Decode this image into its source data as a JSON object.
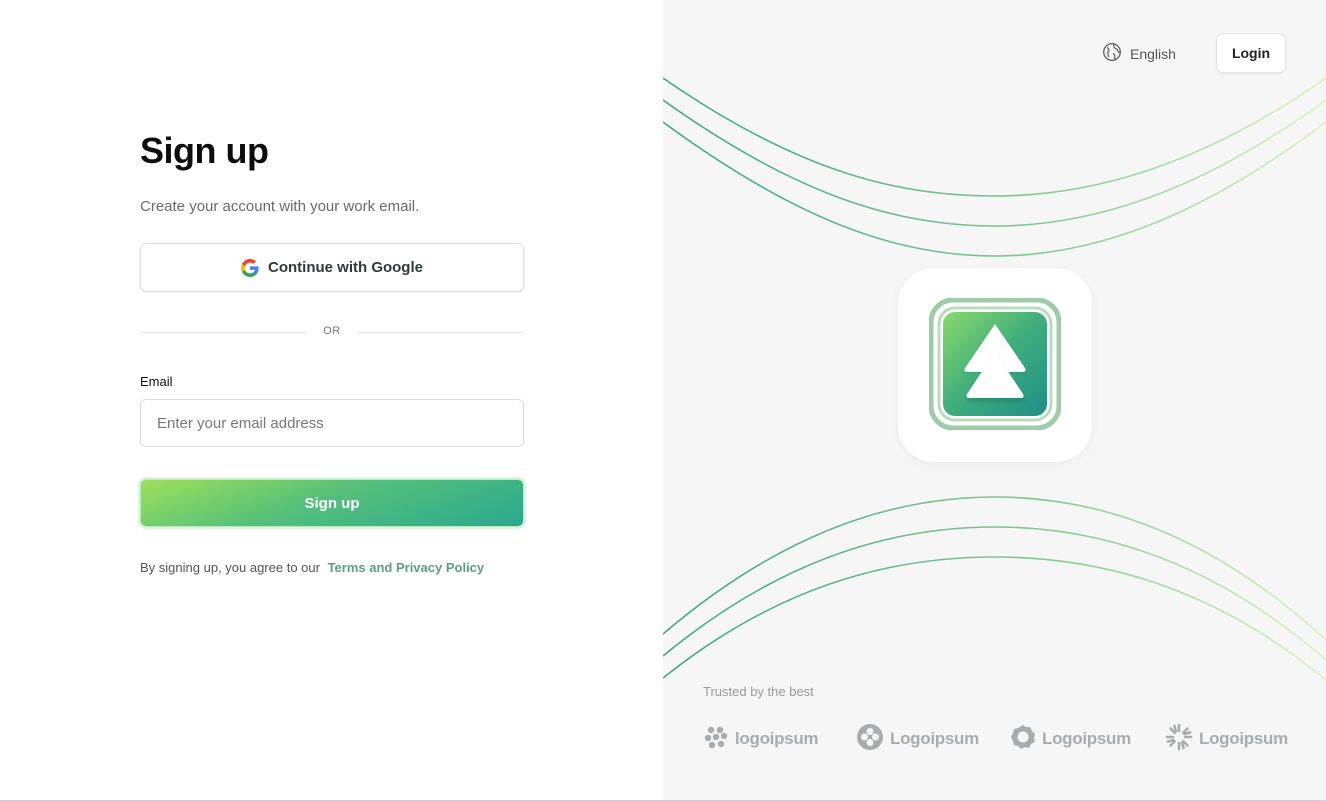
{
  "signup": {
    "title": "Sign up",
    "subtitle": "Create your account with your work email.",
    "google_button": "Continue with Google",
    "divider_text": "OR",
    "email_label": "Email",
    "email_placeholder": "Enter your email address",
    "email_value": "",
    "submit_label": "Sign up",
    "terms_prefix": "By signing up, you agree to our",
    "terms_link": "Terms and Privacy Policy"
  },
  "header": {
    "language": "English",
    "login_label": "Login"
  },
  "trusted": {
    "caption": "Trusted by the best",
    "brands": [
      {
        "name": "logoipsum",
        "icon": "dots-logo-icon"
      },
      {
        "name": "Logoipsum",
        "icon": "circle-clover-logo-icon"
      },
      {
        "name": "Logoipsum",
        "icon": "ring-logo-icon"
      },
      {
        "name": "Logoipsum",
        "icon": "sunburst-logo-icon"
      }
    ]
  },
  "icons": {
    "google": "google-icon",
    "language": "globe-icon",
    "app_logo": "app-logo-icon"
  },
  "colors": {
    "accent_start": "#9ee05a",
    "accent_end": "#2aa88f",
    "link": "#5aa27c",
    "right_panel_bg": "#f6f6f6"
  }
}
